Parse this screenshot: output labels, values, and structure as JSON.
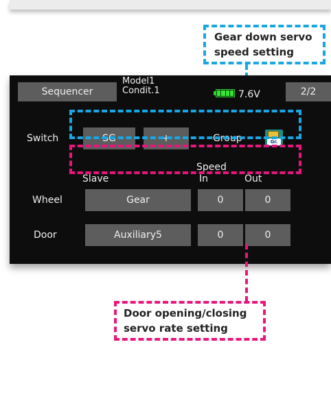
{
  "callouts": {
    "gear_speed": [
      "Gear down servo",
      "speed setting"
    ],
    "door_rate": [
      "Door opening/closing",
      "servo rate setting"
    ]
  },
  "screen": {
    "title": "Sequencer",
    "model": "Model1",
    "condition": "Condit.1",
    "voltage": "7.6V",
    "page": "2/2",
    "switch_label": "Switch",
    "switch_value": "SG",
    "switch_mode": "+",
    "group_label": "Group",
    "group_icon_text": "Gr.",
    "headers": {
      "slave": "Slave",
      "speed": "Speed",
      "in": "In",
      "out": "Out"
    },
    "rows": [
      {
        "name": "Wheel",
        "slave": "Gear",
        "in": "0",
        "out": "0"
      },
      {
        "name": "Door",
        "slave": "Auxiliary5",
        "in": "0",
        "out": "0"
      }
    ]
  },
  "colors": {
    "callout_blue": "#1aa6e3",
    "callout_pink": "#e6177c",
    "button_gray": "#5d5d5d",
    "screen_bg": "#0d0d0d",
    "battery_green": "#39e239"
  }
}
